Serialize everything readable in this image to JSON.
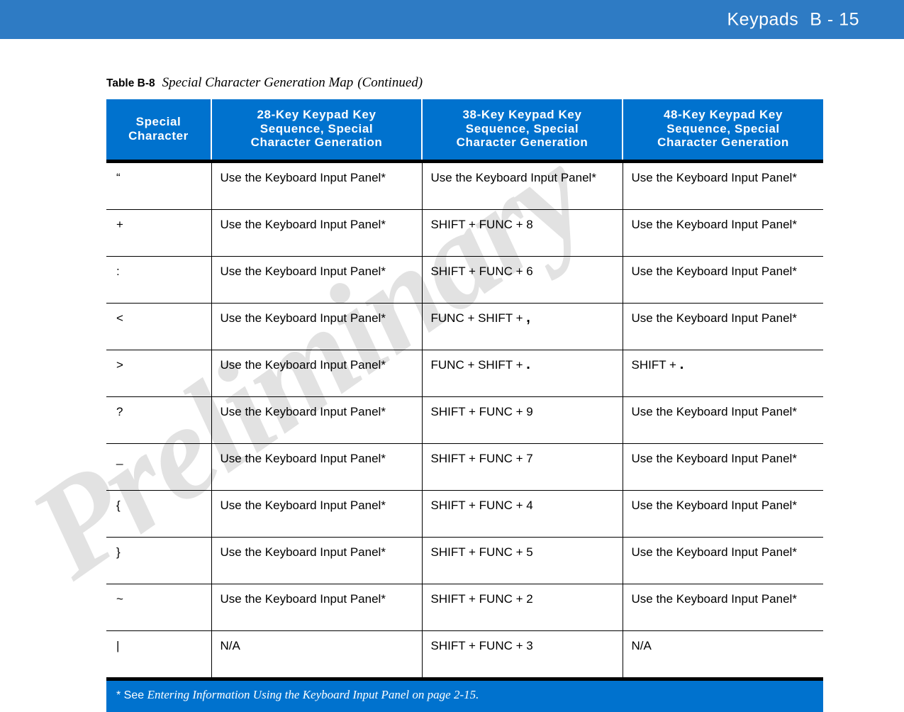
{
  "page_header": {
    "section_title": "Keypads",
    "page_number": "B - 15",
    "background_color": "#2e7bc4",
    "text_color": "#ffffff"
  },
  "watermark": {
    "text": "Preliminary"
  },
  "table": {
    "caption_label": "Table B-8",
    "caption_title": "Special Character Generation Map",
    "caption_continued": "(Continued)",
    "header_background_color": "#0072ce",
    "columns": [
      "Special Character",
      "28-Key Keypad Key Sequence, Special Character Generation",
      "38-Key Keypad Key Sequence, Special Character Generation",
      "48-Key Keypad Key Sequence, Special Character Generation"
    ],
    "columns_lines": [
      [
        "Special",
        "Character"
      ],
      [
        "28-Key Keypad Key",
        "Sequence, Special",
        "Character Generation"
      ],
      [
        "38-Key Keypad Key",
        "Sequence, Special",
        "Character Generation"
      ],
      [
        "48-Key Keypad Key",
        "Sequence, Special",
        "Character Generation"
      ]
    ],
    "rows": [
      {
        "character": "“",
        "key28": "Use the Keyboard Input Panel*",
        "key38": "Use the Keyboard Input Panel*",
        "key48": "Use the Keyboard Input Panel*"
      },
      {
        "character": "+",
        "key28": "Use the Keyboard Input Panel*",
        "key38": "SHIFT + FUNC + 8",
        "key48": "Use the Keyboard Input Panel*"
      },
      {
        "character": ":",
        "key28": "Use the Keyboard Input Panel*",
        "key38": "SHIFT + FUNC + 6",
        "key48": "Use the Keyboard Input Panel*"
      },
      {
        "character": "<",
        "key28": "Use the Keyboard Input Panel*",
        "key38": "FUNC + SHIFT + ,",
        "key38_prefix": "FUNC + SHIFT + ",
        "key38_punct": ",",
        "key48": "Use the Keyboard Input Panel*"
      },
      {
        "character": ">",
        "key28": "Use the Keyboard Input Panel*",
        "key38": "FUNC + SHIFT + .",
        "key38_prefix": "FUNC + SHIFT + ",
        "key38_punct": ".",
        "key48": "SHIFT + .",
        "key48_prefix": "SHIFT + ",
        "key48_punct": "."
      },
      {
        "character": "?",
        "key28": "Use the Keyboard Input Panel*",
        "key38": "SHIFT + FUNC + 9",
        "key48": "Use the Keyboard Input Panel*"
      },
      {
        "character": "_",
        "key28": "Use the Keyboard Input Panel*",
        "key38": "SHIFT + FUNC + 7",
        "key48": "Use the Keyboard Input Panel*"
      },
      {
        "character": "{",
        "key28": "Use the Keyboard Input Panel*",
        "key38": "SHIFT + FUNC + 4",
        "key48": "Use the Keyboard Input Panel*"
      },
      {
        "character": "}",
        "key28": "Use the Keyboard Input Panel*",
        "key38": "SHIFT + FUNC + 5",
        "key48": "Use the Keyboard Input Panel*"
      },
      {
        "character": "~",
        "key28": "Use the Keyboard Input Panel*",
        "key38": "SHIFT + FUNC + 2",
        "key48": "Use the Keyboard Input Panel*"
      },
      {
        "character": "|",
        "key28": "N/A",
        "key38": "SHIFT + FUNC + 3",
        "key48": "N/A"
      }
    ],
    "footnote": {
      "marker": "* See",
      "reference_italic": "Entering Information Using the Keyboard Input Panel on page 2-15.",
      "background_color": "#0072ce"
    }
  }
}
